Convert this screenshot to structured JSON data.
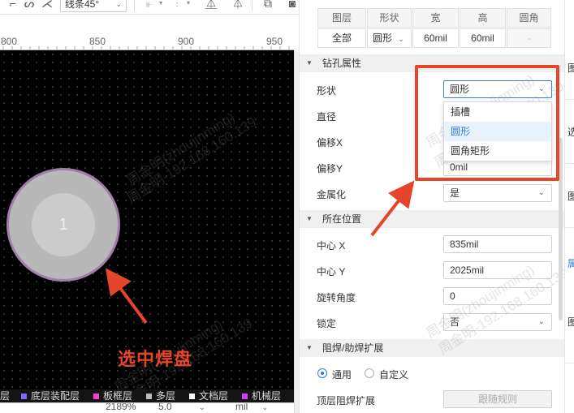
{
  "toolbar": {
    "line_style": "线条45°"
  },
  "ruler": {
    "labels": [
      "800",
      "850",
      "900",
      "950"
    ]
  },
  "canvas": {
    "pad_number": "1",
    "annotation": "选中焊盘",
    "watermark_1": "周金明(zhoujinming)",
    "watermark_2": "周金明-192.168.160.139",
    "colors": {
      "pad_ring": "#9f7fa5",
      "pad": "#b8b8b8",
      "annotation": "#e5452a"
    }
  },
  "layer_bar": {
    "items": [
      {
        "label": "层",
        "color": ""
      },
      {
        "label": "底层装配层",
        "color": "#7b6cff"
      },
      {
        "label": "板框层",
        "color": "#ff3bd4"
      },
      {
        "label": "多层",
        "color": "#bdbdbd"
      },
      {
        "label": "文档层",
        "color": "#ffffff"
      },
      {
        "label": "机械层",
        "color": "#d03bff"
      }
    ]
  },
  "status_bar": {
    "zoom": "2189%",
    "grid": "5.0",
    "unit": "mil"
  },
  "panel": {
    "table": {
      "headers": [
        "图层",
        "形状",
        "宽",
        "高",
        "圆角"
      ],
      "row": [
        "全部",
        "圆形",
        "60mil",
        "60mil",
        "-"
      ]
    },
    "drill_section": "钻孔属性",
    "shape_label": "形状",
    "shape_value": "圆形",
    "shape_options": [
      "插槽",
      "圆形",
      "圆角矩形"
    ],
    "diameter_label": "直径",
    "offset_x_label": "偏移X",
    "offset_y_label": "偏移Y",
    "offset_y_value": "0mil",
    "metallized_label": "金属化",
    "metallized_value": "是",
    "position_section": "所在位置",
    "center_x_label": "中心 X",
    "center_x_value": "835mil",
    "center_y_label": "中心 Y",
    "center_y_value": "2025mil",
    "rotation_label": "旋转角度",
    "rotation_value": "0",
    "lock_label": "锁定",
    "lock_value": "否",
    "mask_section": "阻焊/助焊扩展",
    "mask_opt_general": "通用",
    "mask_opt_custom": "自定义",
    "top_mask_label": "顶层阻焊扩展",
    "top_mask_value": "跟随规则",
    "accent_color": "#2f7be0"
  },
  "right_strip": {
    "glyphs": [
      "图",
      "选",
      "图",
      "属",
      "图"
    ]
  }
}
